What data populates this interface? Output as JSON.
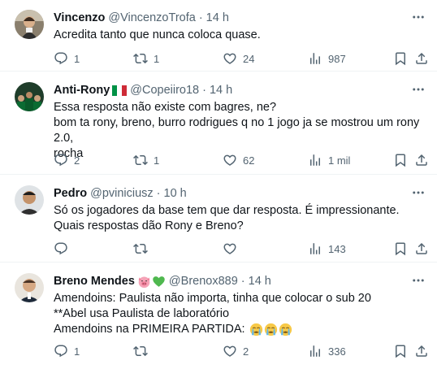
{
  "tweets": [
    {
      "name": "Vincenzo",
      "handle": "@VincenzoTrofa",
      "time": "14 h",
      "lines": [
        "Acredita tanto que nunca coloca quase."
      ],
      "replies": "1",
      "retweets": "1",
      "likes": "24",
      "views": "987"
    },
    {
      "name": "Anti-Rony",
      "handle": "@Copeiiro18",
      "time": "14 h",
      "name_emoji": "italy-flag",
      "lines": [
        "Essa resposta não existe com bagres, ne?",
        "bom ta rony, breno, burro rodrigues q no 1 jogo ja se mostrou um rony 2.0,",
        "rocha"
      ],
      "replies": "2",
      "retweets": "1",
      "likes": "62",
      "views": "1 mil"
    },
    {
      "name": "Pedro",
      "handle": "@pviniciusz",
      "time": "10 h",
      "lines": [
        "Só os jogadores da base tem que dar resposta. É impressionante.",
        "Quais respostas dão Rony e Breno?"
      ],
      "replies": "",
      "retweets": "",
      "likes": "",
      "views": "143"
    },
    {
      "name": "Breno Mendes",
      "handle": "@Brenox889",
      "time": "14 h",
      "name_emoji": "pig-face green-heart",
      "lines": [
        "Amendoins: Paulista não importa, tinha que colocar o sub 20",
        "**Abel usa Paulista de laboratório",
        "Amendoins na PRIMEIRA PARTIDA:"
      ],
      "last_line_emoji": "crying-face crying-face crying-face",
      "replies": "1",
      "retweets": "",
      "likes": "2",
      "views": "336"
    }
  ],
  "separator": "·",
  "colors": {
    "text": "#0f1419",
    "muted": "#536471",
    "divider": "#eff3f4"
  }
}
